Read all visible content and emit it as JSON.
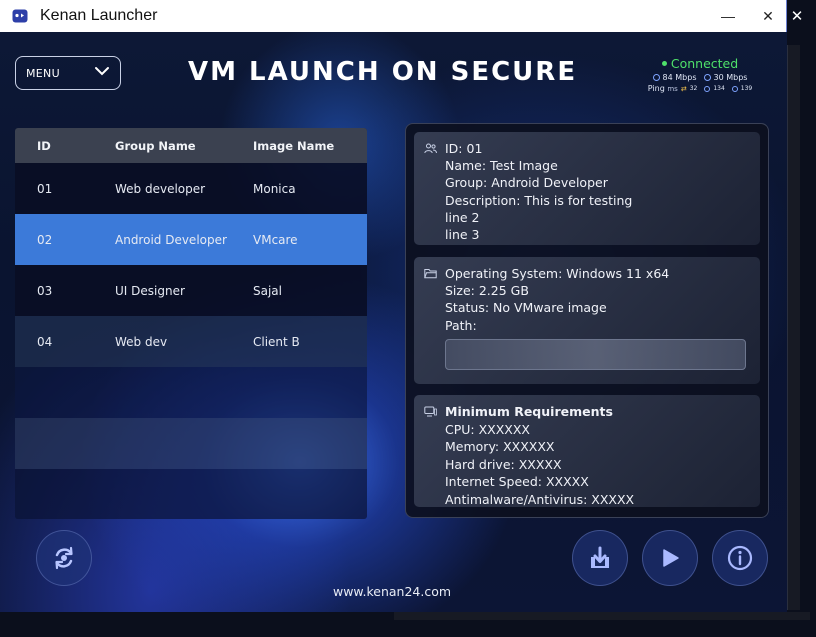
{
  "window": {
    "title": "Kenan Launcher",
    "minimize_label": "—",
    "close_label": "✕",
    "outer_close_label": "✕"
  },
  "header": {
    "menu_label": "MENU",
    "app_title": "VM LAUNCH ON SECURE",
    "connection": {
      "status": "Connected",
      "download": "84 Mbps",
      "upload": "30 Mbps",
      "ping_label": "Ping",
      "ping_unit": "ms",
      "ping_values": [
        "32",
        "134",
        "139"
      ]
    }
  },
  "table": {
    "columns": [
      "ID",
      "Group Name",
      "Image Name"
    ],
    "rows": [
      {
        "id": "01",
        "group": "Web developer",
        "image": "Monica"
      },
      {
        "id": "02",
        "group": "Android Developer",
        "image": "VMcare"
      },
      {
        "id": "03",
        "group": "UI Designer",
        "image": "Sajal"
      },
      {
        "id": "04",
        "group": "Web dev",
        "image": "Client B"
      }
    ],
    "selected_row": "02"
  },
  "details": {
    "info": {
      "id_line": "ID:  01",
      "name_line": "Name:  Test Image",
      "group_line": "Group:  Android Developer",
      "description_line": "Description:  This is for testing",
      "line2": "line 2",
      "line3": "line 3"
    },
    "system": {
      "os_line": "Operating System: Windows 11 x64",
      "size_line": "Size: 2.25 GB",
      "status_line": "Status: No VMware image",
      "path_label": "Path:",
      "path_value": ""
    },
    "requirements": {
      "heading": "Minimum Requirements",
      "cpu_line": "CPU: XXXXXX",
      "memory_line": "Memory: XXXXXX",
      "hdd_line": "Hard drive:  XXXXX",
      "internet_line": "Internet Speed:  XXXXX",
      "antivirus_line": "Antimalware/Antivirus: XXXXX"
    }
  },
  "footer": {
    "url": "www.kenan24.com"
  },
  "colors": {
    "accent_blue": "#3c7ad9",
    "connected_green": "#4ee06a",
    "background": "#0b0f1c"
  },
  "icons": [
    "app-icon",
    "chevron-down-icon",
    "user-group-icon",
    "folder-icon",
    "monitor-icon",
    "refresh-icon",
    "download-icon",
    "play-icon",
    "info-icon"
  ]
}
